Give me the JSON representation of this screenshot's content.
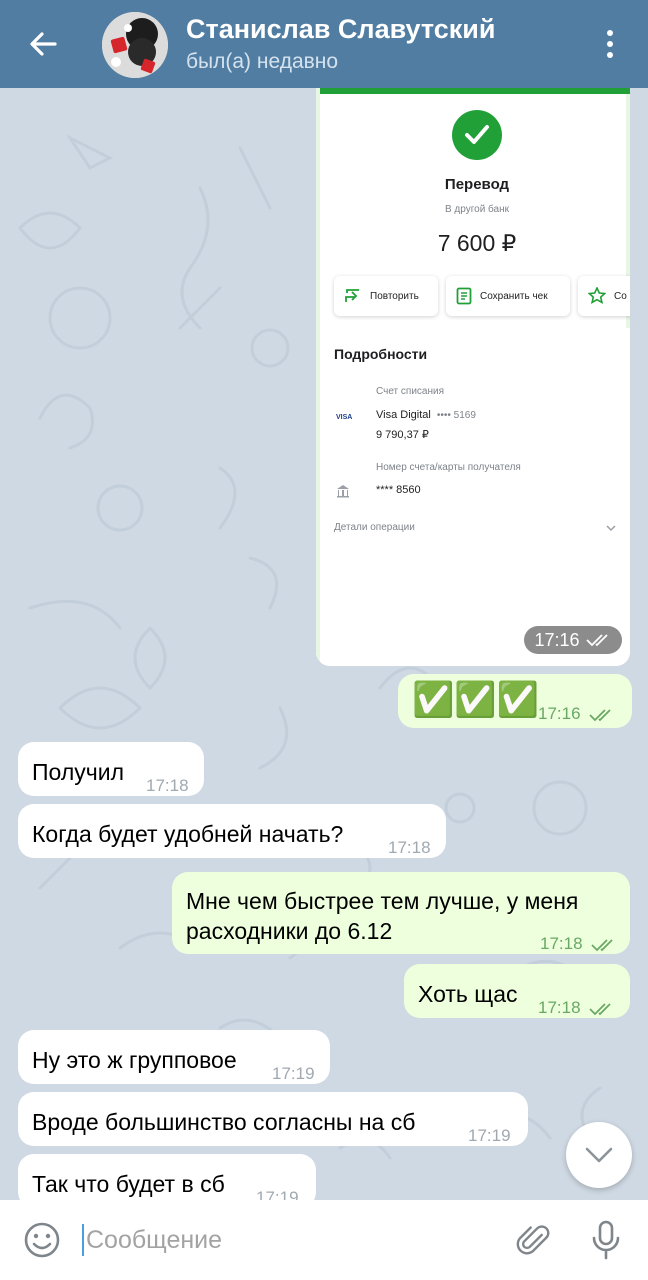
{
  "header": {
    "title": "Станислав Славутский",
    "status": "был(а) недавно"
  },
  "receipt": {
    "title": "Перевод",
    "subtitle": "В другой банк",
    "amount": "7 600 ₽",
    "repeat_label": "Повторить",
    "save_label": "Сохранить чек",
    "third_label": "Со",
    "details_title": "Подробности",
    "debit_account_label": "Счет списания",
    "card_name": "Visa Digital",
    "card_mask": "•••• 5169",
    "balance": "9 790,37 ₽",
    "visa_label": "VISA",
    "recipient_label": "Номер счета/карты получателя",
    "recipient_mask": "**** 8560",
    "operation_details_label": "Детали операции",
    "time": "17:16"
  },
  "messages": [
    {
      "dir": "out",
      "text": "✅✅✅",
      "time": "17:16"
    },
    {
      "dir": "in",
      "text": "Получил",
      "time": "17:18"
    },
    {
      "dir": "in",
      "text": "Когда будет удобней начать?",
      "time": "17:18"
    },
    {
      "dir": "out",
      "text_line1": "Мне чем быстрее тем лучше, у меня",
      "text_line2": "расходники до 6.12",
      "time": "17:18"
    },
    {
      "dir": "out",
      "text": "Хоть щас",
      "time": "17:18"
    },
    {
      "dir": "in",
      "text": "Ну это ж групповое",
      "time": "17:19"
    },
    {
      "dir": "in",
      "text": "Вроде большинство согласны на сб",
      "time": "17:19"
    },
    {
      "dir": "in",
      "text": "Так что будет в сб",
      "time": "17:19"
    }
  ],
  "input": {
    "placeholder": "Сообщение"
  },
  "icons": {
    "back": "arrow-left-icon",
    "menu": "kebab-menu-icon",
    "emoji": "smile-icon",
    "attach": "paperclip-icon",
    "mic": "microphone-icon",
    "scroll": "chevron-down-icon"
  },
  "colors": {
    "header": "#517da2",
    "incoming_bubble": "#ffffff",
    "outgoing_bubble": "#eeffde",
    "sber_green": "#21a038",
    "chat_bg": "#cfd9e3"
  }
}
